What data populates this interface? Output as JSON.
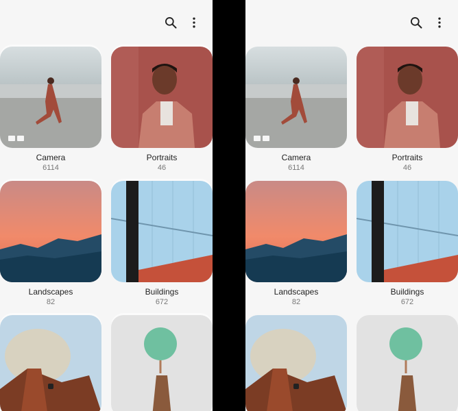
{
  "toolbar": {
    "search_icon": "search-icon",
    "more_icon": "more-vert-icon"
  },
  "albums": [
    {
      "name": "Camera",
      "count": "6114"
    },
    {
      "name": "Portraits",
      "count": "46"
    },
    {
      "name": "Landscapes",
      "count": "82"
    },
    {
      "name": "Buildings",
      "count": "672"
    },
    {
      "name": "",
      "count": ""
    },
    {
      "name": "",
      "count": ""
    }
  ],
  "colors": {
    "background": "#f6f6f6",
    "text": "#222222",
    "count_text": "#777777"
  }
}
